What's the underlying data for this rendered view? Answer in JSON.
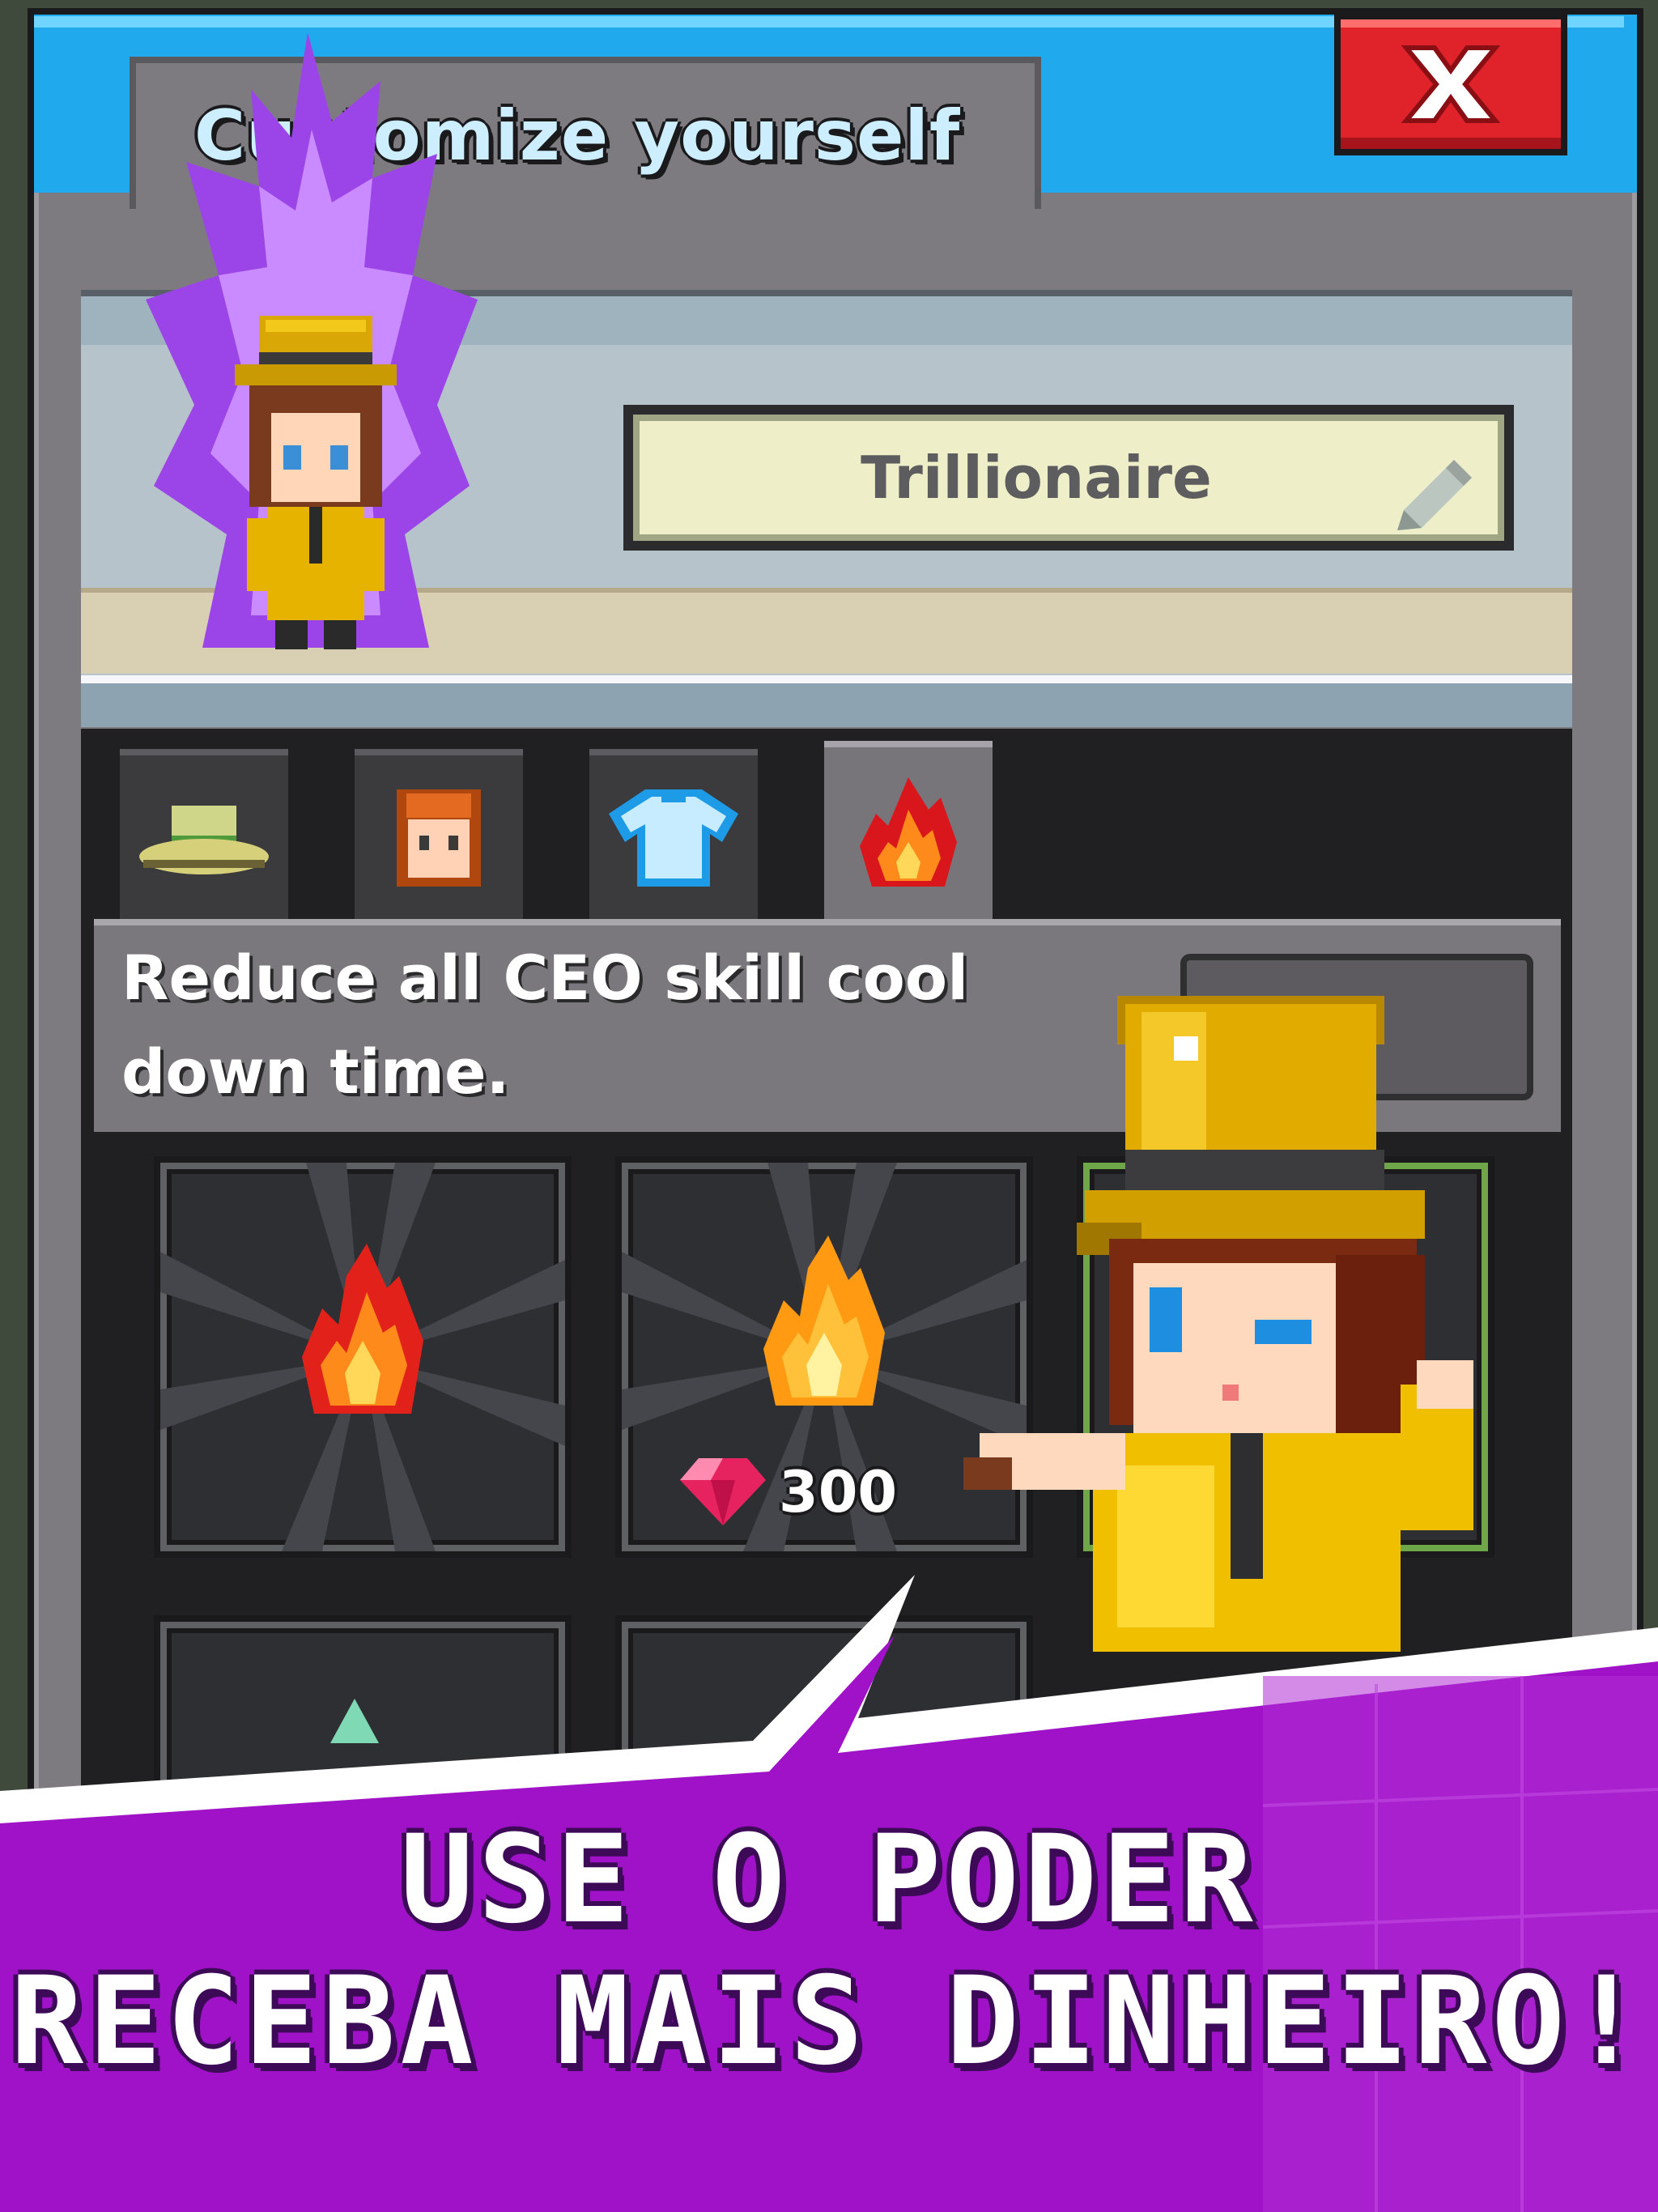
{
  "window": {
    "title": "Customize yourself",
    "close_label": "✕"
  },
  "profile": {
    "name": "Trillionaire"
  },
  "tabs": [
    {
      "name": "hat",
      "icon": "hat-icon"
    },
    {
      "name": "hair",
      "icon": "face-icon"
    },
    {
      "name": "outfit",
      "icon": "shirt-icon"
    },
    {
      "name": "aura",
      "icon": "fire-icon",
      "active": true
    }
  ],
  "description": {
    "line1": "Reduce all CEO skill cool",
    "line2": "down time."
  },
  "items": [
    {
      "icon": "fire-icon",
      "price": ""
    },
    {
      "icon": "fire-icon",
      "price": "300",
      "currency_icon": "gem-icon"
    }
  ],
  "banner": {
    "line1": "USE O PODER",
    "line2": "RECEBA MAIS DINHEIRO!"
  },
  "colors": {
    "title_bar": "#21a9ee",
    "close_button": "#e0232b",
    "banner": "#a012c8",
    "flame": "#ff8a1c",
    "aura": "#b45cff"
  }
}
